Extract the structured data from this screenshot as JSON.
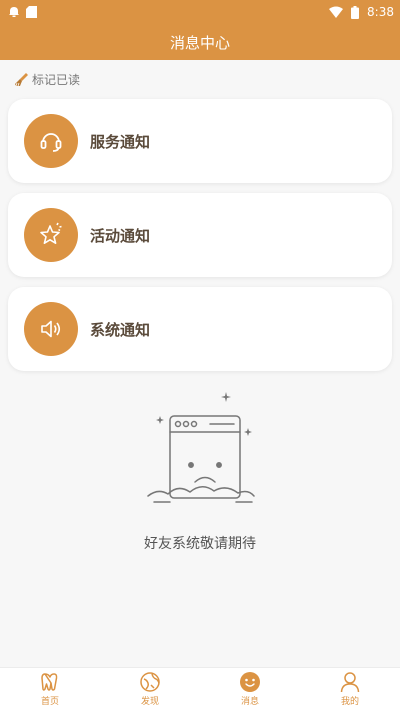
{
  "status_bar": {
    "time": "8:38"
  },
  "header": {
    "title": "消息中心"
  },
  "mark_read": {
    "label": "标记已读"
  },
  "notifications": [
    {
      "label": "服务通知",
      "icon": "headset-icon"
    },
    {
      "label": "活动通知",
      "icon": "star-icon"
    },
    {
      "label": "系统通知",
      "icon": "speaker-icon"
    }
  ],
  "empty_state": {
    "text": "好友系统敬请期待",
    "icon": "sad-window-icon"
  },
  "tabs": [
    {
      "label": "首页",
      "icon": "home-icon"
    },
    {
      "label": "发现",
      "icon": "compass-icon"
    },
    {
      "label": "消息",
      "icon": "message-icon",
      "active": true
    },
    {
      "label": "我的",
      "icon": "profile-icon"
    }
  ],
  "colors": {
    "accent": "#db9343",
    "background": "#f7f7f7"
  }
}
